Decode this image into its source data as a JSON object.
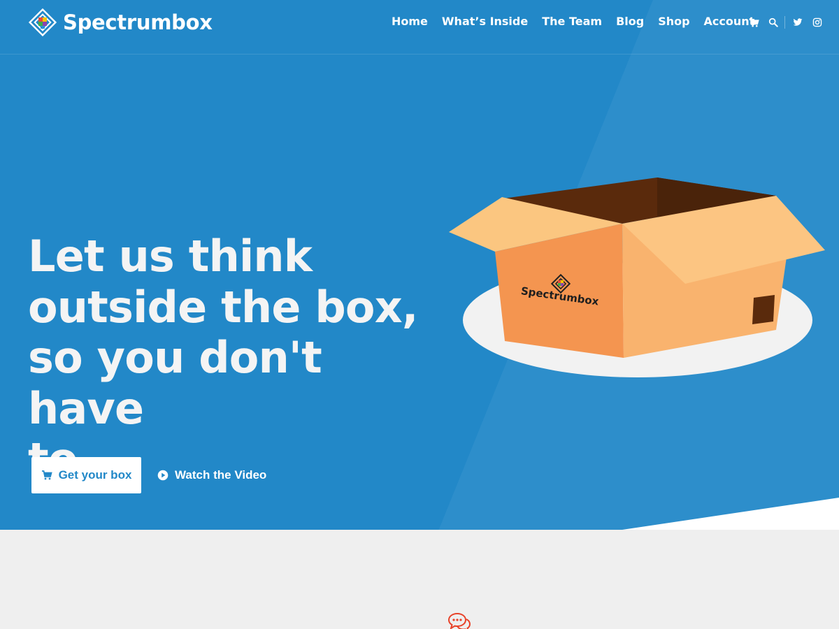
{
  "header": {
    "brand": "Spectrumbox",
    "nav": [
      {
        "label": "Home"
      },
      {
        "label": "What’s Inside"
      },
      {
        "label": "The Team"
      },
      {
        "label": "Blog"
      },
      {
        "label": "Shop"
      },
      {
        "label": "Account"
      }
    ],
    "icons": [
      "cart-icon",
      "search-icon",
      "twitter-icon",
      "instagram-icon"
    ]
  },
  "hero": {
    "headline_lines": [
      "Let us think",
      "outside the box,",
      "so you don't have",
      "to."
    ],
    "primary_button": {
      "label": "Get your box",
      "icon": "cart-icon"
    },
    "secondary_button": {
      "label": "Watch the Video",
      "icon": "play-circle-icon"
    },
    "box_label": "Spectrumbox"
  },
  "lower": {
    "icon": "chat-bubbles-icon"
  },
  "colors": {
    "hero_bg": "#2288c8",
    "page_bg": "#efefef",
    "accent": "#e8432a",
    "button_bg": "#ffffff",
    "button_text": "#2288c8"
  }
}
